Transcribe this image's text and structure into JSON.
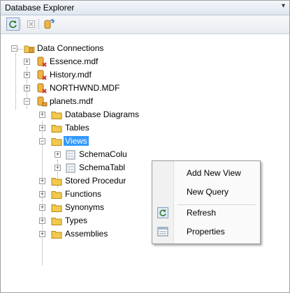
{
  "window": {
    "title": "Database Explorer",
    "pin_glyph": "▾"
  },
  "toolbar": {
    "buttons": [
      {
        "name": "refresh-button",
        "icon": "refresh-icon"
      },
      {
        "name": "stop-button",
        "icon": "close-icon"
      },
      {
        "name": "connect-button",
        "icon": "connect-database-icon"
      }
    ]
  },
  "tree": {
    "root": "Data Connections",
    "connections": [
      {
        "label": "Essence.mdf",
        "state": "disconnected"
      },
      {
        "label": "History.mdf",
        "state": "disconnected"
      },
      {
        "label": "NORTHWND.MDF",
        "state": "disconnected"
      },
      {
        "label": "planets.mdf",
        "state": "connected"
      }
    ],
    "folders": [
      "Database Diagrams",
      "Tables",
      "Views",
      "Stored Procedur",
      "Functions",
      "Synonyms",
      "Types",
      "Assemblies"
    ],
    "views_children": [
      "SchemaColu",
      "SchemaTabl"
    ],
    "selected": "Views"
  },
  "context_menu": {
    "items": [
      {
        "label": "Add New View",
        "icon": ""
      },
      {
        "label": "New Query",
        "icon": ""
      },
      {
        "label": "Refresh",
        "icon": "refresh-icon"
      },
      {
        "label": "Properties",
        "icon": "properties-icon"
      }
    ]
  },
  "colors": {
    "selection": "#3399ff",
    "folder": "#f2c94c",
    "database": "#e8a13a",
    "error_mark": "#d32f2f"
  }
}
